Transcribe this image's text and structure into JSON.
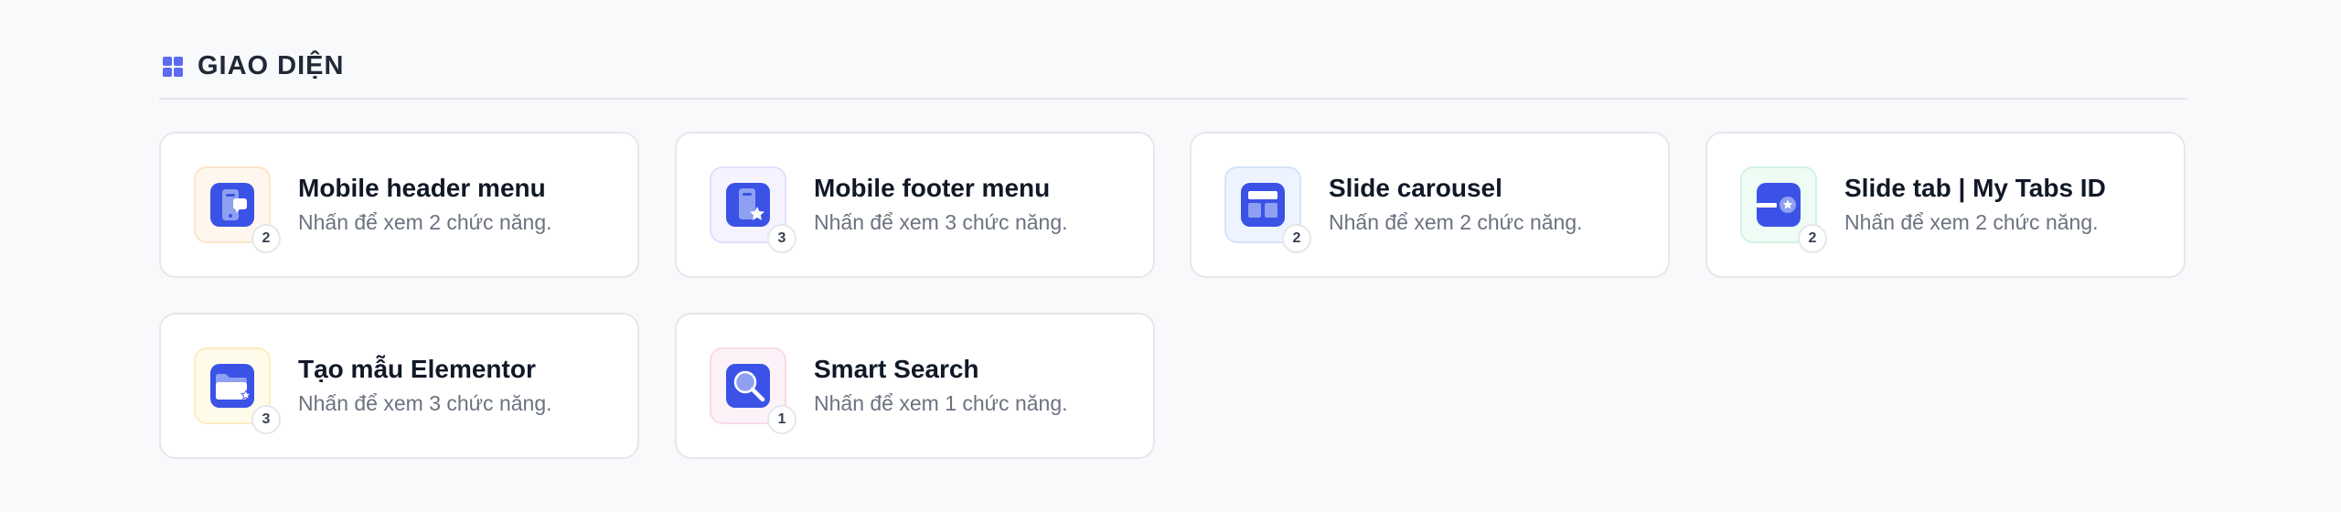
{
  "section": {
    "icon": "grid-icon",
    "title": "GIAO DIỆN"
  },
  "colors": {
    "accent": "#3b52e6",
    "accent_light": "#8fa0f2"
  },
  "cards": [
    {
      "title": "Mobile header menu",
      "subtitle": "Nhấn để xem 2 chức năng.",
      "count": "2",
      "icon": "mobile-header-icon",
      "tint_bg": "#fff7ed",
      "tint_border": "#fde4c8"
    },
    {
      "title": "Mobile footer menu",
      "subtitle": "Nhấn để xem 3 chức năng.",
      "count": "3",
      "icon": "mobile-footer-icon",
      "tint_bg": "#f5f3ff",
      "tint_border": "#e4defb"
    },
    {
      "title": "Slide carousel",
      "subtitle": "Nhấn để xem 2 chức năng.",
      "count": "2",
      "icon": "carousel-icon",
      "tint_bg": "#eef4ff",
      "tint_border": "#d7e3fb"
    },
    {
      "title": "Slide tab | My Tabs ID",
      "subtitle": "Nhấn để xem 2 chức năng.",
      "count": "2",
      "icon": "tabs-icon",
      "tint_bg": "#effcf5",
      "tint_border": "#d2f3e0"
    },
    {
      "title": "Tạo mẫu Elementor",
      "subtitle": "Nhấn để xem 3 chức năng.",
      "count": "3",
      "icon": "template-folder-icon",
      "tint_bg": "#fffbeb",
      "tint_border": "#fbedc1"
    },
    {
      "title": "Smart Search",
      "subtitle": "Nhấn để xem 1 chức năng.",
      "count": "1",
      "icon": "search-icon",
      "tint_bg": "#fdf2f8",
      "tint_border": "#f7dbe9"
    }
  ]
}
